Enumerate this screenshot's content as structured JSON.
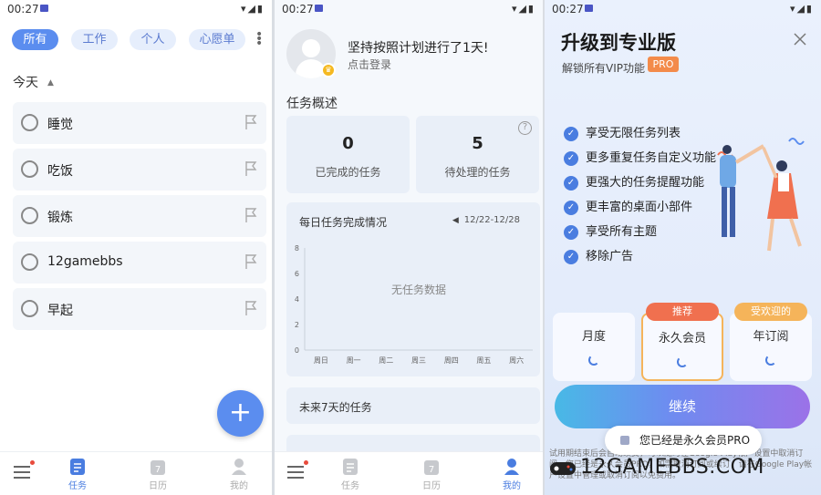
{
  "status": {
    "time": "00:27"
  },
  "tasks_screen": {
    "chips": [
      "所有",
      "工作",
      "个人",
      "心愿单"
    ],
    "section": "今天",
    "tasks": [
      "睡觉",
      "吃饭",
      "锻炼",
      "12gamebbs",
      "早起"
    ],
    "fab": "+"
  },
  "profile_screen": {
    "motto": "坚持按照计划进行了1天!",
    "login": "点击登录",
    "overview_title": "任务概述",
    "completed_count": "0",
    "completed_label": "已完成的任务",
    "pending_count": "5",
    "pending_label": "待处理的任务",
    "help": "?",
    "chart_title": "每日任务完成情况",
    "date_range": "12/22-12/28",
    "no_data": "无任务数据",
    "future_title": "未来7天的任务"
  },
  "chart_data": {
    "type": "bar",
    "categories": [
      "周日",
      "周一",
      "周二",
      "周三",
      "周四",
      "周五",
      "周六"
    ],
    "values": [
      0,
      0,
      0,
      0,
      0,
      0,
      0
    ],
    "title": "每日任务完成情况",
    "ylim": [
      0,
      8
    ],
    "yticks": [
      "0",
      "2",
      "4",
      "6",
      "8"
    ],
    "grid": false
  },
  "nav": {
    "items": [
      "任务",
      "日历",
      "我的"
    ],
    "calendar_icon_number": "7"
  },
  "pro_screen": {
    "title": "升级到专业版",
    "subtitle": "解锁所有VIP功能",
    "badge": "PRO",
    "features": [
      "享受无限任务列表",
      "更多重复任务自定义功能",
      "更强大的任务提醒功能",
      "更丰富的桌面小部件",
      "享受所有主题",
      "移除广告"
    ],
    "plans": [
      {
        "name": "月度",
        "tag": ""
      },
      {
        "name": "永久会员",
        "tag": "推荐"
      },
      {
        "name": "年订阅",
        "tag": "受欢迎的"
      }
    ],
    "continue": "继续",
    "toast": "您已经是永久会员PRO",
    "fine_print": "试用期结束后会自动续费，可以随时在Google Play帐户设置中取消订阅。您已经是永久会员PRO，如需取消订阅或续订，请在Google Play帐户设置中管理或取消订阅以免费用。",
    "watermark": "12GAMEBBS.COM"
  },
  "colors": {
    "accent": "#5b8def",
    "pro_badge": "#f38b4a",
    "tag_recommend": "#f0704f",
    "tag_popular": "#f5b45a"
  }
}
